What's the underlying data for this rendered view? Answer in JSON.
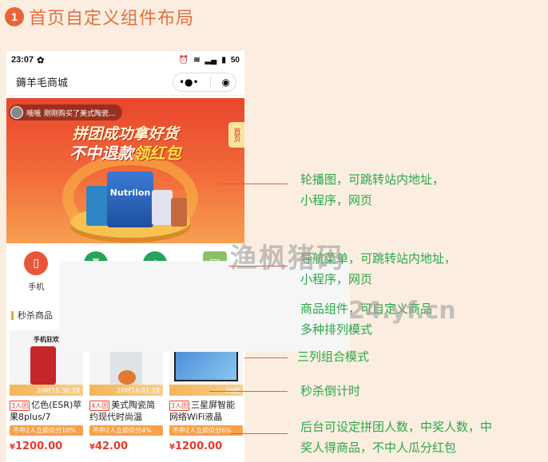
{
  "header": {
    "step_number": "1",
    "title": "首页自定义组件布局"
  },
  "status_bar": {
    "time": "23:07",
    "battery": "50"
  },
  "nav_bar": {
    "title": "薅羊毛商城",
    "more_icon": "dots-icon",
    "close_icon": "target-icon"
  },
  "banner": {
    "ticker_user": "哦哦",
    "ticker_text": "刚刚购买了美式陶瓷...",
    "headline_line1": "拼团成功拿好货",
    "headline_line2_prefix": "不中退款",
    "headline_line2_highlight": "领红包",
    "side_tag": "首页",
    "product_label": "Nutrilon"
  },
  "nav_menu": [
    {
      "label": "手机",
      "icon": "phone-icon",
      "color": "#e8563a"
    },
    {
      "label": "",
      "icon": "robot-icon",
      "color": "#27a35b"
    },
    {
      "label": "",
      "icon": "home-icon",
      "color": "#27a35b"
    },
    {
      "label": "",
      "icon": "card-icon",
      "color": "#8cbf6a"
    }
  ],
  "section": {
    "title": "秒杀商品"
  },
  "products": [
    {
      "image_caption": "手机狂欢",
      "countdown": "20时15:30:18",
      "group_tag": "3人团",
      "name": "亿色(ESR)苹果8plus/7",
      "promo": "不中2人立即瓜分10%",
      "currency": "¥",
      "price": "1200.00"
    },
    {
      "image_caption": "",
      "countdown": "26时16:01:18",
      "group_tag": "4人团",
      "name": "美式陶瓷简约现代时尚温",
      "promo": "不中2人立即瓜分4%",
      "currency": "¥",
      "price": "42.00"
    },
    {
      "image_caption": "",
      "countdown": "26时",
      "group_tag": "3人团",
      "name": "三星屏智能网络WiFi液晶",
      "promo": "不中2人立即瓜分6%",
      "currency": "¥",
      "price": "1200.00"
    }
  ],
  "annotations": {
    "banner_line1": "轮播图，可跳转站内地址，",
    "banner_line2": "小程序，网页",
    "nav_line1": "导航菜单，可跳转站内地址，",
    "nav_line2": "小程序，网页",
    "goods_line1": "商品组件，可自定义商品",
    "goods_line2": "多种排列模式",
    "three_col": "三列组合模式",
    "countdown": "秒杀倒计时",
    "group_line1": "后台可设定拼团人数，中奖人数，中",
    "group_line2": "奖人得商品，不中人瓜分红包"
  },
  "watermark": {
    "text1": "渔枫猪码",
    "text2": "24.yf.cn"
  }
}
